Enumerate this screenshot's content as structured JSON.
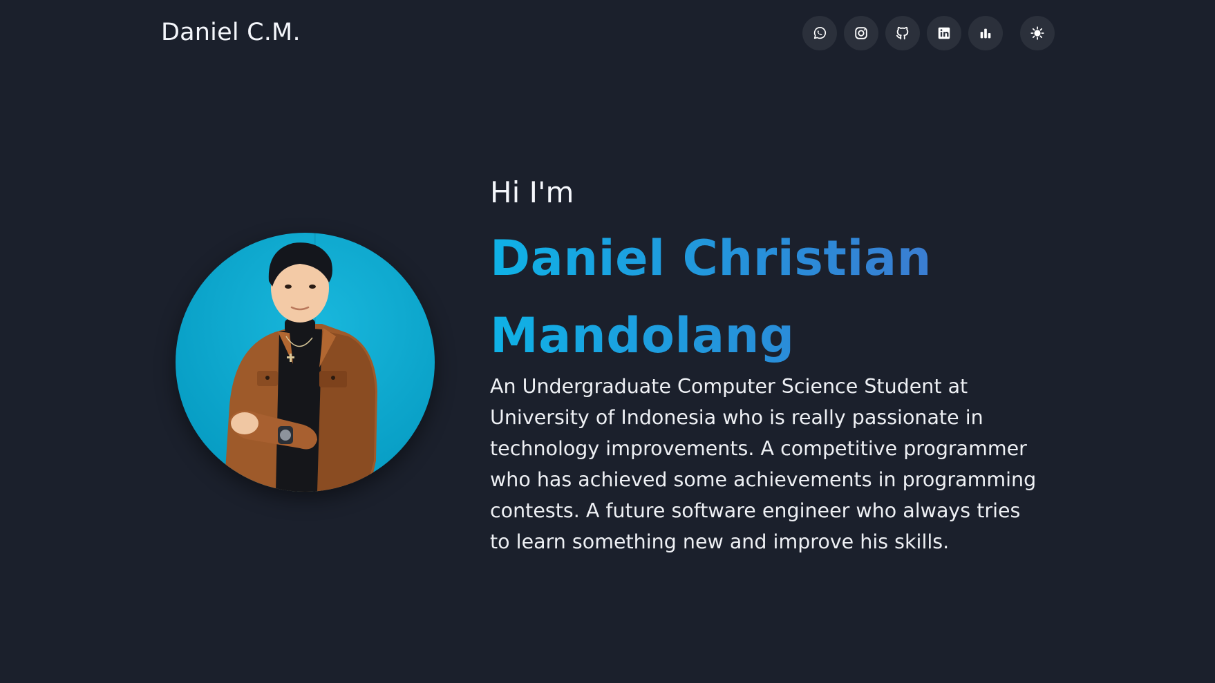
{
  "header": {
    "brand": "Daniel C.M.",
    "links": [
      {
        "name": "whatsapp",
        "icon": "whatsapp-icon"
      },
      {
        "name": "instagram",
        "icon": "instagram-icon"
      },
      {
        "name": "github",
        "icon": "github-icon"
      },
      {
        "name": "linkedin",
        "icon": "linkedin-icon"
      },
      {
        "name": "stats",
        "icon": "bar-chart-icon"
      }
    ],
    "theme_toggle_icon": "sun-icon"
  },
  "hero": {
    "greeting": "Hi I'm",
    "name": "Daniel Christian Mandolang",
    "bio": "An Undergraduate Computer Science Student at University of Indonesia who is really passionate in technology improvements. A competitive programmer who has achieved some achievements in programming contests. A future software engineer who always tries to learn something new and improve his skills.",
    "photo": "profile-photo"
  },
  "colors": {
    "background": "#1b202c",
    "icon_button": "#2b303b",
    "gradient_start": "#0fb2e6",
    "gradient_end": "#4a70cc",
    "photo_background": "#0aa8cc"
  }
}
